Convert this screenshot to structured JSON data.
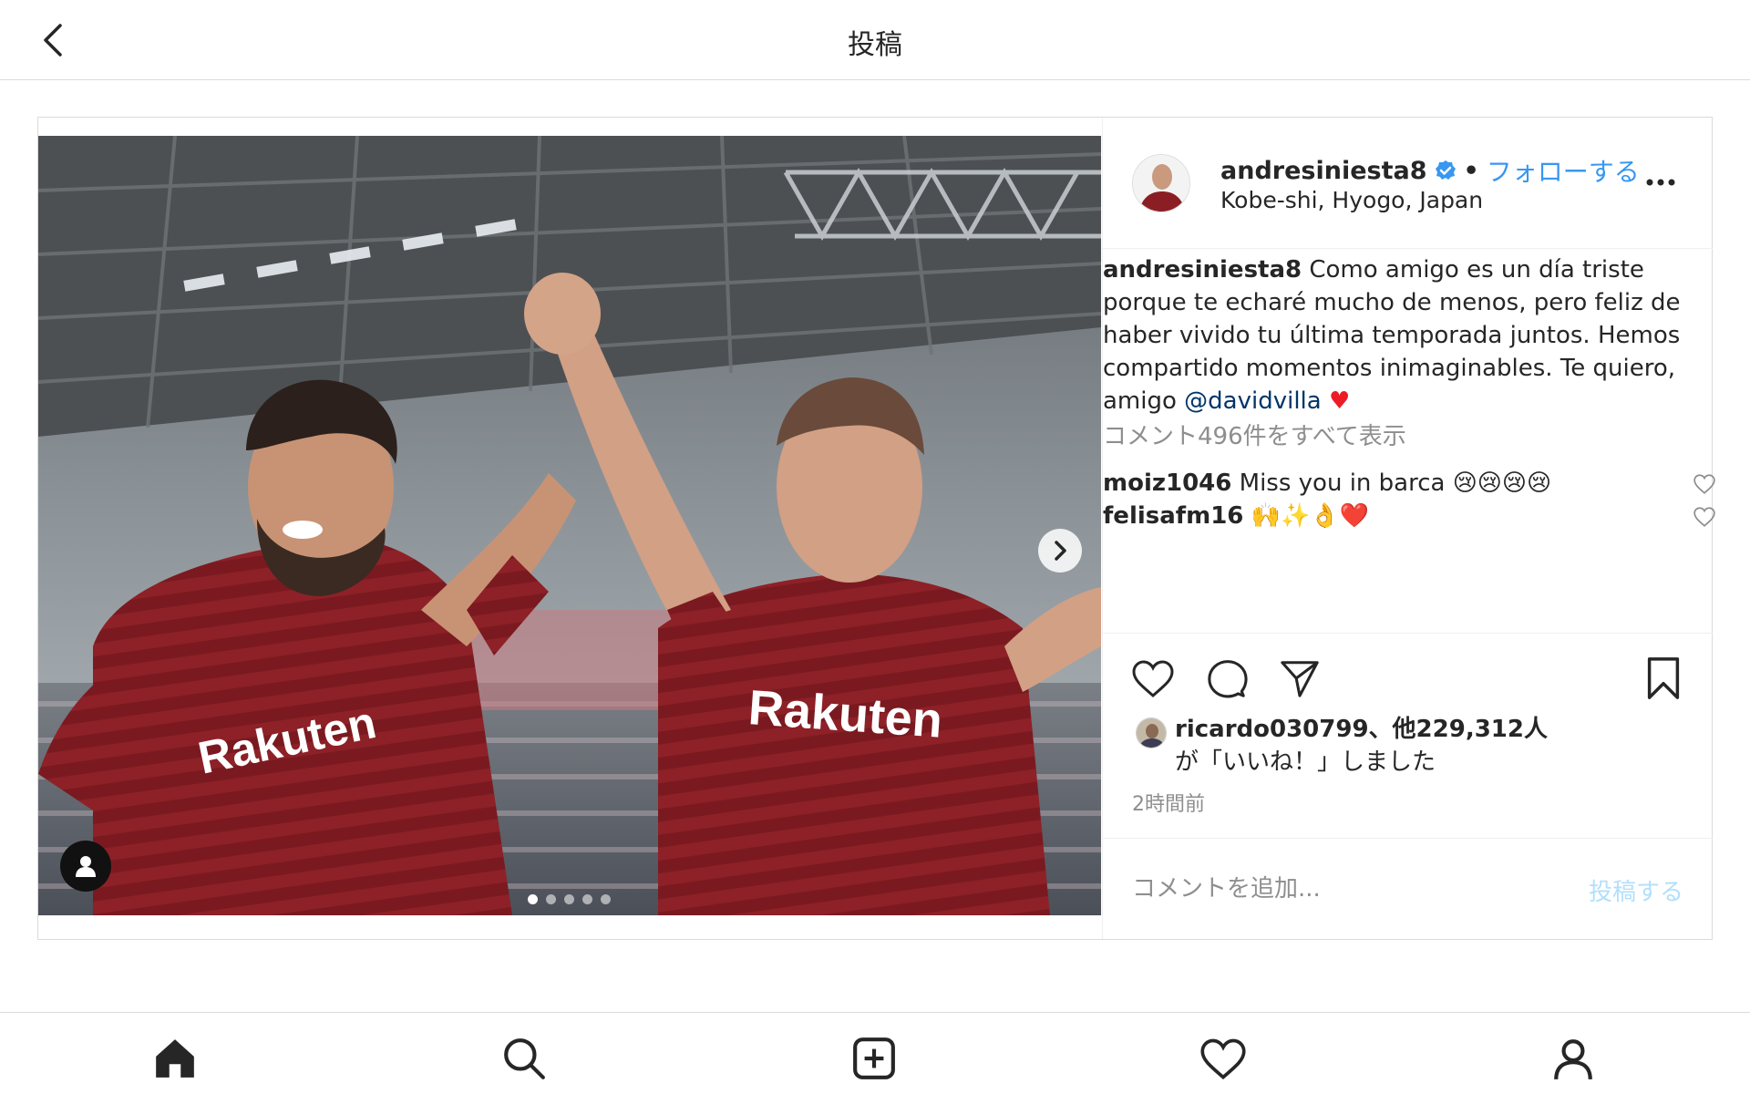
{
  "header": {
    "title": "投稿"
  },
  "post": {
    "username": "andresiniesta8",
    "follow_label": "フォローする",
    "location": "Kobe-shi, Hyogo, Japan",
    "caption_user": "andresiniesta8",
    "caption_text": "Como amigo es un día triste porque te echaré mucho de menos, pero feliz de haber vivido tu última temporada juntos. Hemos compartido momentos inimaginables. Te quiero, amigo",
    "caption_mention": "@davidvilla",
    "caption_emoji": "♥",
    "view_all_comments": "コメント496件をすべて表示",
    "comments": [
      {
        "user": "moiz1046",
        "text": "Miss you in barca 😢😢😢😢"
      },
      {
        "user": "felisafm16",
        "text": "🙌✨👌❤️"
      }
    ],
    "liked_by_user": "ricardo030799",
    "liked_by_count": "、他229,312人",
    "liked_by_suffix": "が「いいね！」しました",
    "time_ago": "2時間前",
    "comment_placeholder": "コメントを追加...",
    "post_button": "投稿する",
    "carousel": {
      "total": 5,
      "current": 1
    }
  },
  "photo": {
    "jersey_text_left": "Rakuten",
    "jersey_text_right": "Rakuten"
  },
  "colors": {
    "link": "#3897f0",
    "muted": "#8e8e8e",
    "border": "#dbdbdb",
    "jersey": "#8b1e24"
  }
}
